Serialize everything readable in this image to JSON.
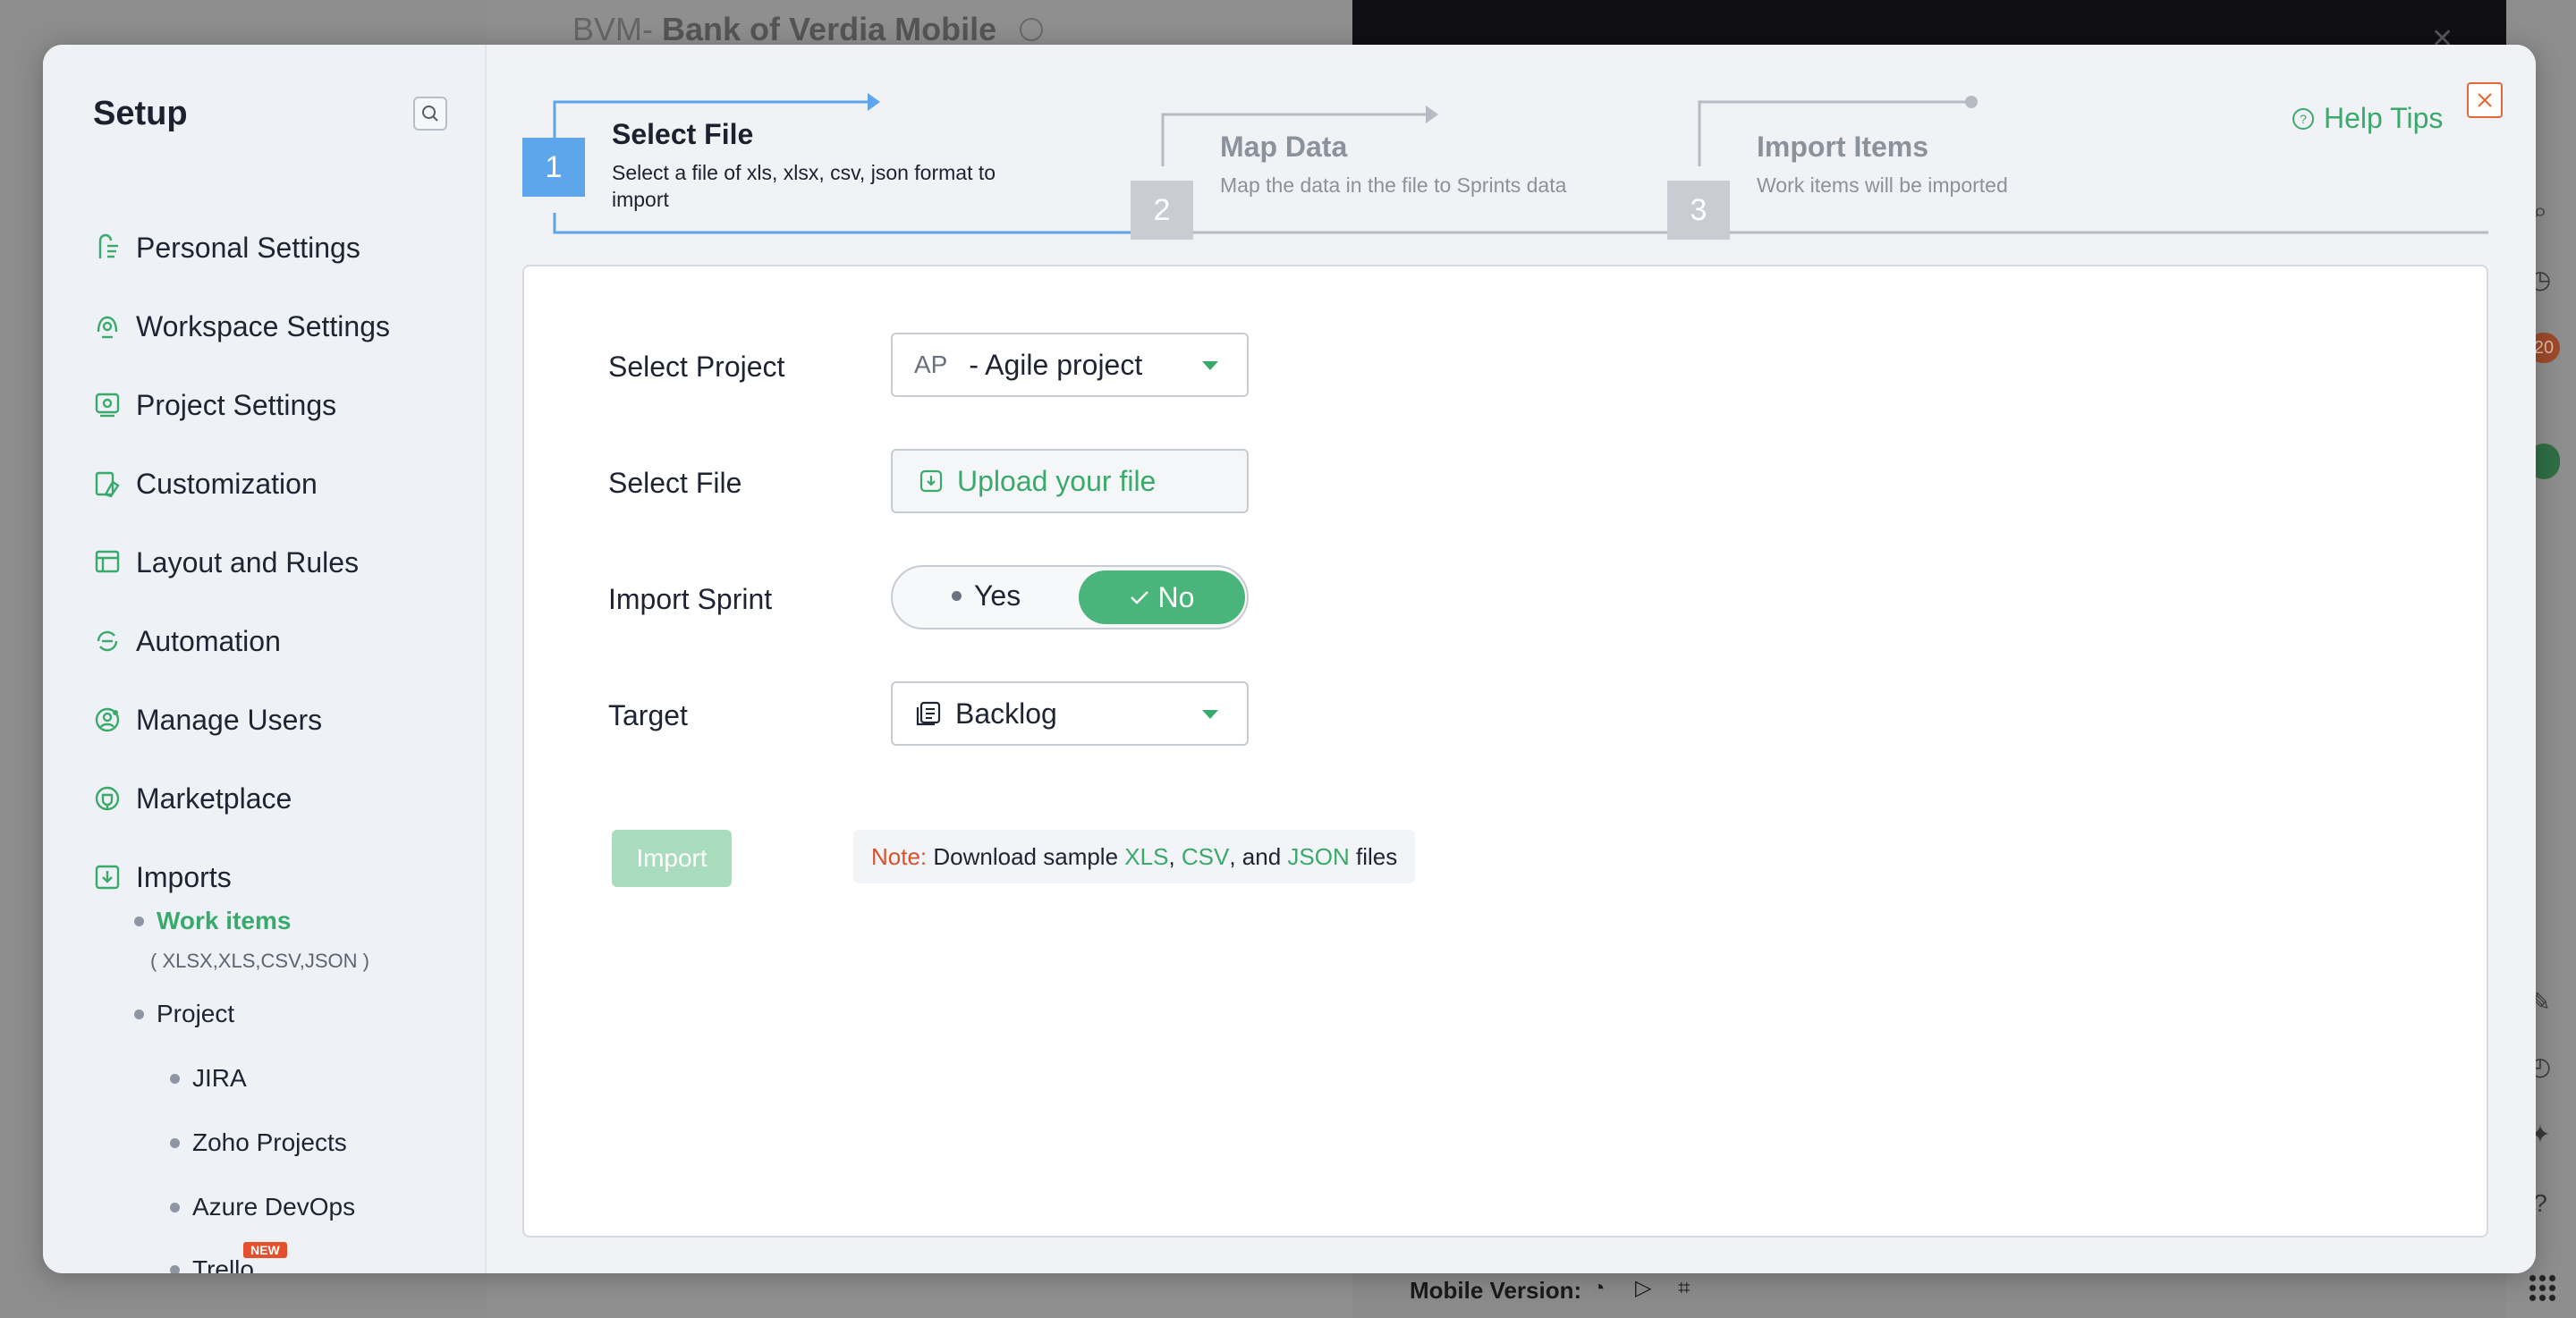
{
  "background": {
    "project_prefix": "BVM-",
    "project_name": "Bank of Verdia Mobile",
    "mobile_version_label": "Mobile Version:",
    "badge_count": "20"
  },
  "sidebar": {
    "title": "Setup",
    "items": [
      {
        "label": "Personal Settings",
        "icon": "personal-settings-icon"
      },
      {
        "label": "Workspace Settings",
        "icon": "workspace-settings-icon"
      },
      {
        "label": "Project Settings",
        "icon": "project-settings-icon"
      },
      {
        "label": "Customization",
        "icon": "customization-icon"
      },
      {
        "label": "Layout and Rules",
        "icon": "layout-rules-icon"
      },
      {
        "label": "Automation",
        "icon": "automation-icon"
      },
      {
        "label": "Manage Users",
        "icon": "manage-users-icon"
      },
      {
        "label": "Marketplace",
        "icon": "marketplace-icon"
      },
      {
        "label": "Imports",
        "icon": "imports-icon"
      }
    ],
    "imports_sub": {
      "work_items": "Work items",
      "work_items_note": "( XLSX,XLS,CSV,JSON )",
      "project": "Project",
      "project_children": [
        "JIRA",
        "Zoho Projects",
        "Azure DevOps",
        "Trello"
      ],
      "new_badge": "NEW"
    }
  },
  "stepper": {
    "steps": [
      {
        "number": "1",
        "title": "Select File",
        "desc": "Select a file of xls, xlsx, csv, json format to import"
      },
      {
        "number": "2",
        "title": "Map Data",
        "desc": "Map the data in the file to Sprints data"
      },
      {
        "number": "3",
        "title": "Import Items",
        "desc": "Work items will be imported"
      }
    ],
    "help_label": "Help Tips"
  },
  "form": {
    "select_project_label": "Select Project",
    "project_code": "AP",
    "project_name": "- Agile project",
    "select_file_label": "Select File",
    "upload_label": "Upload your file",
    "import_sprint_label": "Import Sprint",
    "toggle_yes": "Yes",
    "toggle_no": "No",
    "toggle_selected": "No",
    "target_label": "Target",
    "target_value": "Backlog",
    "import_button": "Import",
    "note_label": "Note:",
    "note_text": " Download sample ",
    "note_xls": "XLS",
    "note_sep1": ", ",
    "note_csv": "CSV",
    "note_sep2": ", and ",
    "note_json": "JSON",
    "note_end": " files"
  },
  "colors": {
    "accent_green": "#3aaa6c",
    "active_step_blue": "#5ea6ec",
    "inactive_step_gray": "#c9cdd3",
    "note_red": "#d9512c",
    "close_orange": "#e06b3a"
  }
}
